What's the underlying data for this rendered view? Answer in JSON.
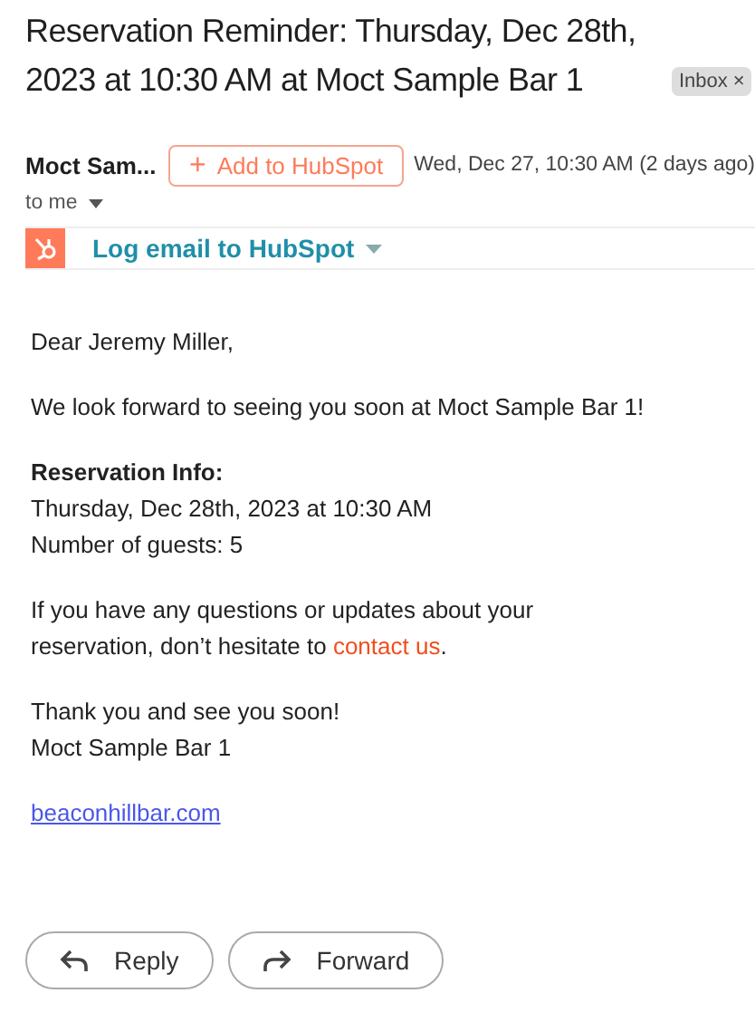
{
  "subject": "Reservation Reminder: Thursday, Dec 28th, 2023 at 10:30 AM at Moct Sample Bar 1",
  "label": {
    "text": "Inbox",
    "close": "×"
  },
  "sender": "Moct Sam...",
  "add_button": {
    "icon": "+",
    "label": "Add to HubSpot"
  },
  "date": "Wed, Dec 27, 10:30 AM (2 days ago)",
  "recipient": "to me",
  "hubspot_bar": {
    "label": "Log email to HubSpot"
  },
  "body": {
    "greeting": "Dear Jeremy Miller,",
    "intro": "We look forward to seeing you soon at Moct Sample Bar 1!",
    "info_heading": "Reservation Info:",
    "info_lines": [
      "Thursday, Dec 28th, 2023 at 10:30 AM",
      "Number of guests: 5"
    ],
    "contact": {
      "before": "If you have any questions or updates about your reservation, don’t hesitate to ",
      "link": "contact us",
      "after": "."
    },
    "closing_lines": [
      "Thank you and see you soon!",
      "Moct Sample Bar 1"
    ],
    "website": "beaconhillbar.com"
  },
  "actions": [
    {
      "kind": "reply",
      "label": "Reply"
    },
    {
      "kind": "forward",
      "label": "Forward"
    }
  ]
}
